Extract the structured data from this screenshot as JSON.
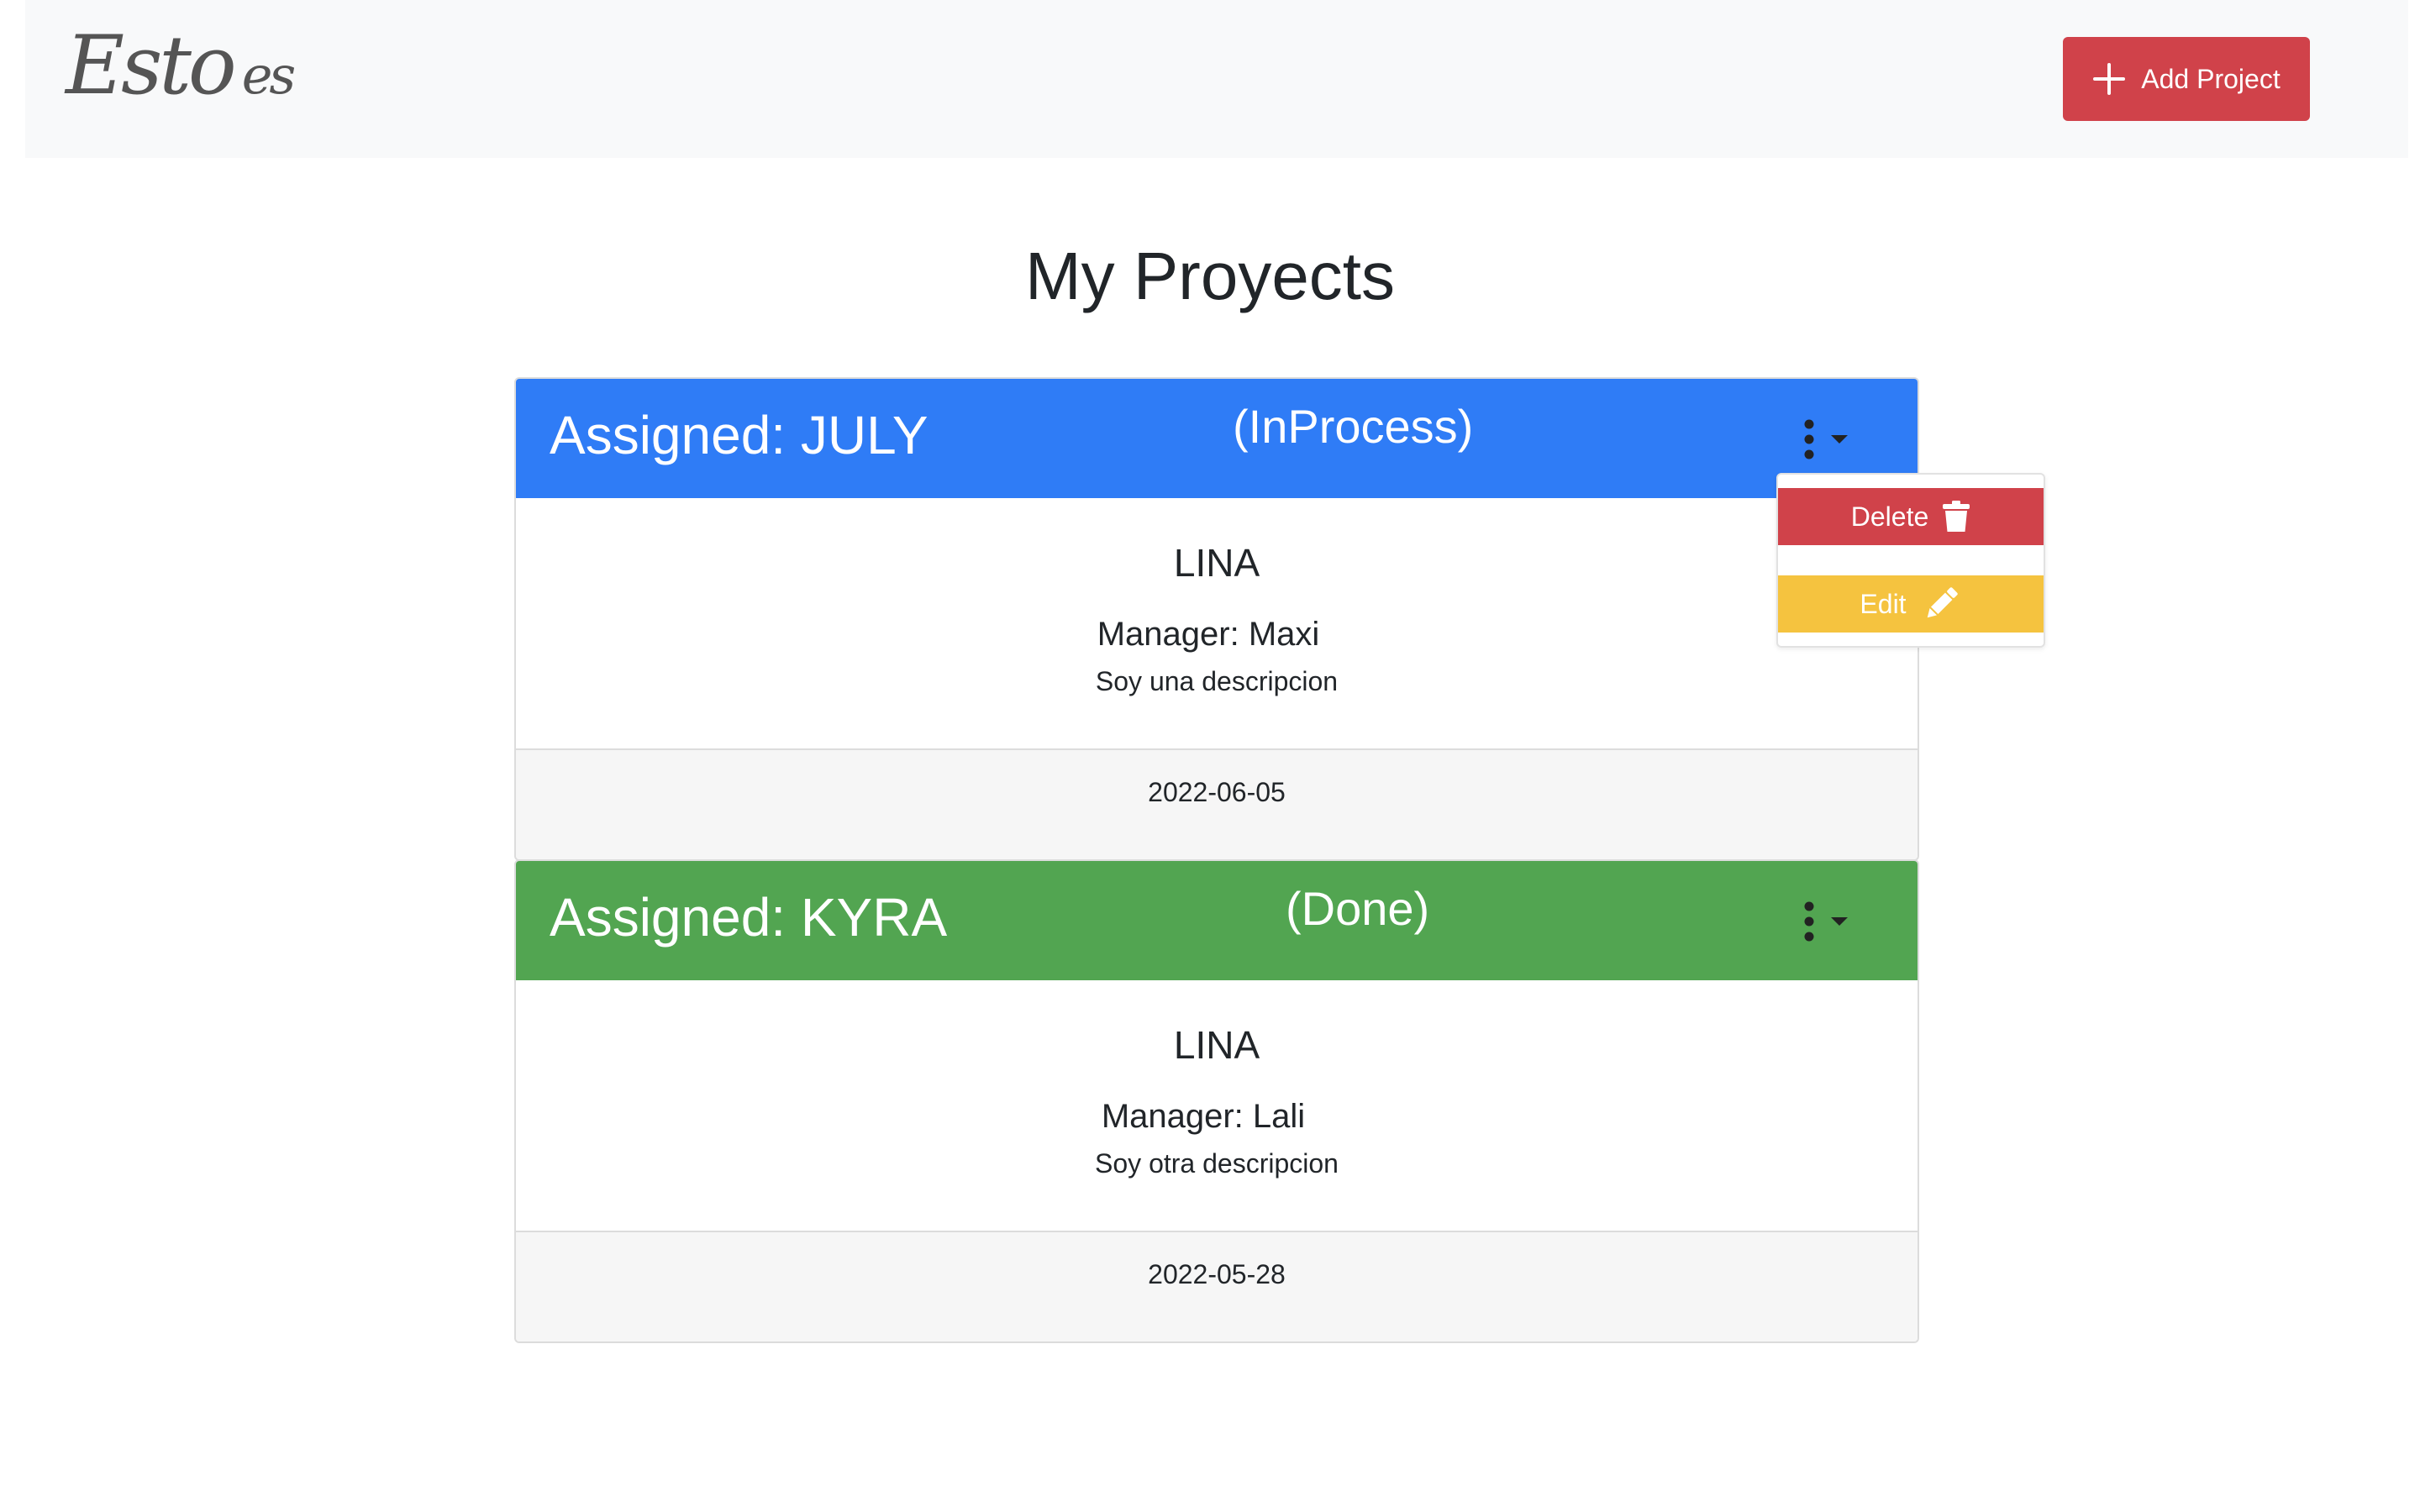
{
  "navbar": {
    "logo_main": "Esto",
    "logo_small": "es",
    "add_label": "Add Project"
  },
  "page": {
    "title": "My Proyects"
  },
  "projects": [
    {
      "assigned": "Assigned: JULY",
      "status": "(InProcess)",
      "name": "LINA",
      "manager": "Manager: Maxi",
      "description": "Soy una descripcion",
      "date": "2022-06-05",
      "header_color": "#2f7cf6"
    },
    {
      "assigned": "Assigned: KYRA",
      "status": "(Done)",
      "name": "LINA",
      "manager": "Manager: Lali",
      "description": "Soy otra descripcion",
      "date": "2022-05-28",
      "header_color": "#52a551"
    }
  ],
  "dropdown": {
    "delete_label": "Delete",
    "edit_label": "Edit"
  },
  "icons": {
    "add": "plus-icon",
    "menu": "kebab-icon",
    "caret": "caret-down-icon",
    "delete": "trash-icon",
    "edit": "pencil-icon"
  },
  "colors": {
    "danger": "#d0424a",
    "warning": "#f5c33f",
    "primary": "#2f7cf6",
    "success": "#52a551"
  }
}
